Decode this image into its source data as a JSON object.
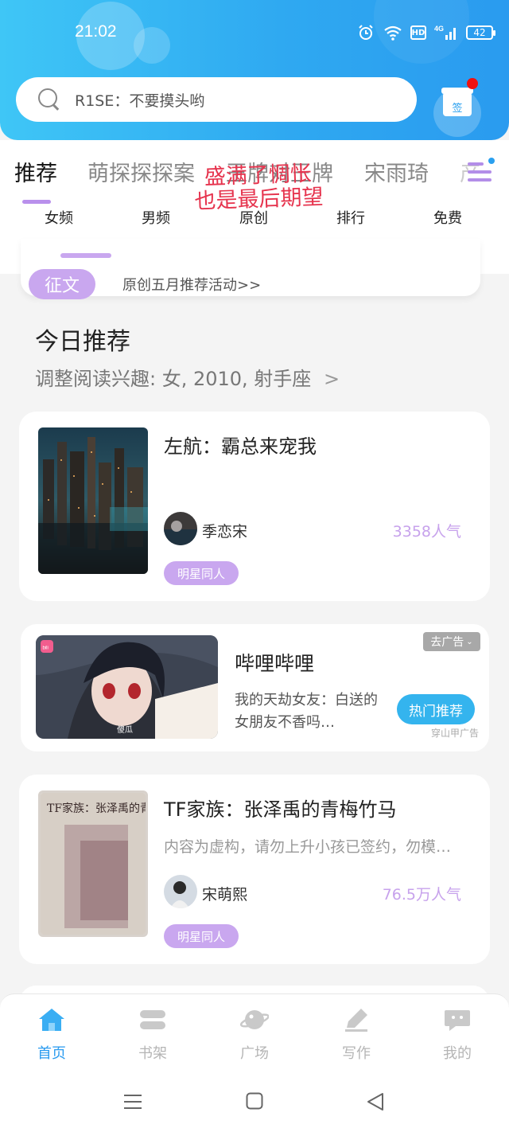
{
  "status_bar": {
    "time": "21:02",
    "battery": "42",
    "network": "4G",
    "hd": "HD"
  },
  "search": {
    "placeholder": "R1SE：不要摸头哟"
  },
  "gift": {
    "label": "签"
  },
  "tabs": [
    {
      "label": "推荐",
      "active": true
    },
    {
      "label": "萌探探探案",
      "active": false
    },
    {
      "label": "王牌对王牌",
      "active": false
    },
    {
      "label": "宋雨琦",
      "active": false
    },
    {
      "label": "产",
      "active": false
    }
  ],
  "overlay": {
    "line1": "盛满了惆怅",
    "line2": "也是最后期望"
  },
  "subnav": [
    "女频",
    "男频",
    "原创",
    "排行",
    "免费"
  ],
  "promo": {
    "badge": "征文",
    "text": "原创五月推荐活动>>"
  },
  "section": {
    "title": "今日推荐",
    "subtitle": "调整阅读兴趣: 女, 2010, 射手座",
    "chevron": ">"
  },
  "books": [
    {
      "title": "左航：霸总来宠我",
      "description": "",
      "author": "季恋宋",
      "popularity": "3358人气",
      "tag": "明星同人"
    },
    {
      "title": "TF家族：张泽禹的青梅竹马",
      "description": "内容为虚构，请勿上升小孩已签约，勿模…",
      "author": "宋萌熙",
      "popularity": "76.5万人气",
      "tag": "明星同人"
    }
  ],
  "cover_text": {
    "book2": "TF家族：张泽禹的青梅竹马"
  },
  "ad": {
    "title": "哔哩哔哩",
    "description": "我的天劫女友：白送的女朋友不香吗…",
    "button": "热门推荐",
    "close": "去广告",
    "source": "穿山甲广告",
    "logo": "bili",
    "caption": "傻瓜"
  },
  "bottom_nav": [
    {
      "label": "首页",
      "icon": "home-icon",
      "active": true
    },
    {
      "label": "书架",
      "icon": "bookshelf-icon",
      "active": false
    },
    {
      "label": "广场",
      "icon": "planet-icon",
      "active": false
    },
    {
      "label": "写作",
      "icon": "pen-icon",
      "active": false
    },
    {
      "label": "我的",
      "icon": "chat-icon",
      "active": false
    }
  ],
  "colors": {
    "header_start": "#3fc6f6",
    "header_end": "#2a9bef",
    "accent_purple": "#c9a7ef",
    "nav_active": "#2a9bef",
    "ad_button": "#34b4ee"
  }
}
